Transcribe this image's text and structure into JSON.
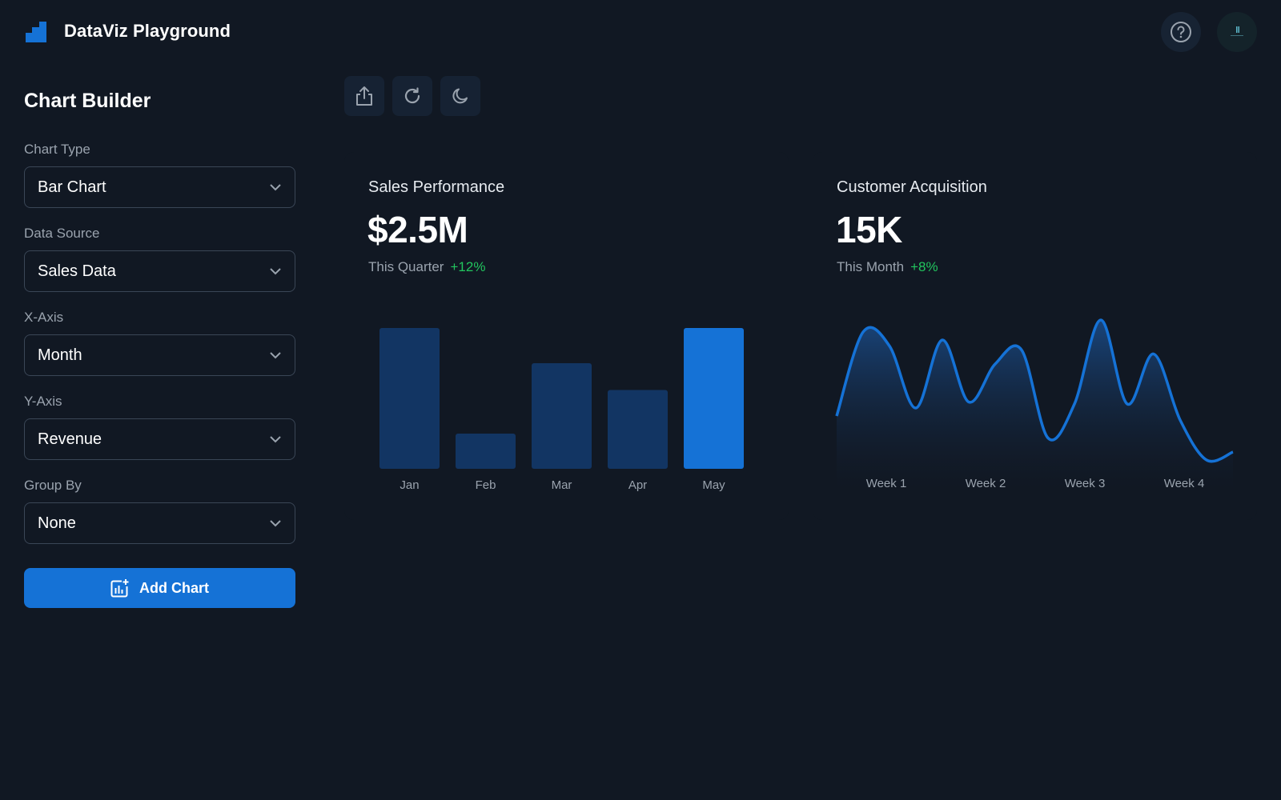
{
  "app": {
    "title": "DataViz Playground"
  },
  "header": {
    "help_icon": "help-circle-icon",
    "avatar_icon": "user-avatar"
  },
  "sidebar": {
    "title": "Chart Builder",
    "fields": [
      {
        "label": "Chart Type",
        "value": "Bar Chart"
      },
      {
        "label": "Data Source",
        "value": "Sales Data"
      },
      {
        "label": "X-Axis",
        "value": "Month"
      },
      {
        "label": "Y-Axis",
        "value": "Revenue"
      },
      {
        "label": "Group By",
        "value": "None"
      }
    ],
    "add_button_label": "Add Chart"
  },
  "toolbar": {
    "buttons": [
      "share-icon",
      "refresh-icon",
      "moon-icon"
    ]
  },
  "cards": [
    {
      "title": "Sales Performance",
      "value": "$2.5M",
      "period": "This Quarter",
      "change": "+12%"
    },
    {
      "title": "Customer Acquisition",
      "value": "15K",
      "period": "This Month",
      "change": "+8%"
    }
  ],
  "colors": {
    "background": "#111823",
    "accent": "#1572d6",
    "bar_muted": "#123563",
    "positive": "#22c55e"
  },
  "chart_data": [
    {
      "type": "bar",
      "categories": [
        "Jan",
        "Feb",
        "Mar",
        "Apr",
        "May"
      ],
      "values": [
        100,
        25,
        75,
        56,
        100
      ],
      "highlight": "May",
      "ylim": [
        0,
        100
      ]
    },
    {
      "type": "area",
      "x_labels": [
        "Week 1",
        "Week 2",
        "Week 3",
        "Week 4"
      ],
      "values": [
        36,
        78,
        71,
        40,
        74,
        43,
        62,
        69,
        25,
        42,
        84,
        42,
        67,
        34,
        14,
        18
      ],
      "ylim": [
        0,
        100
      ]
    }
  ]
}
